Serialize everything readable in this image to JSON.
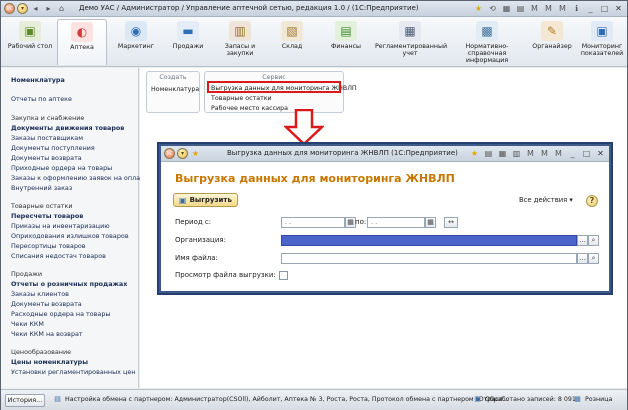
{
  "window": {
    "title": "Демо УАС / Администратор / Управление аптечной сетью, редакция 1.0 / (1С:Предприятие)"
  },
  "toolbar": {
    "items": [
      {
        "label": "Рабочий стол",
        "icon": "desktop-icon"
      },
      {
        "label": "Аптека",
        "icon": "pill-icon"
      },
      {
        "label": "Маркетинг",
        "icon": "marketing-icon"
      },
      {
        "label": "Продажи",
        "icon": "cart-icon"
      },
      {
        "label": "Запасы и закупки",
        "icon": "stock-icon"
      },
      {
        "label": "Склад",
        "icon": "warehouse-icon"
      },
      {
        "label": "Финансы",
        "icon": "money-icon"
      },
      {
        "label": "Регламентированный учет",
        "icon": "regulated-icon"
      },
      {
        "label": "Нормативно-справочная информация",
        "icon": "reference-icon"
      },
      {
        "label": "Органайзер",
        "icon": "organizer-icon"
      },
      {
        "label": "Мониторинг показателей",
        "icon": "monitor-icon"
      }
    ]
  },
  "nav": {
    "nomenclature": "Номенклатура",
    "reports": "Отчеты по аптеке",
    "s1_title": "Закупка и снабжение",
    "s1_bold": "Документы движения товаров",
    "s1_items": [
      "Заказы поставщикам",
      "Документы поступления",
      "Документы возврата",
      "Приходные ордера на товары",
      "Заказы к оформлению заявок на оплату",
      "Внутренний заказ"
    ],
    "s2_title": "Товарные остатки",
    "s2_bold": "Пересчеты товаров",
    "s2_items": [
      "Приказы на инвентаризацию",
      "Оприходования излишков товаров",
      "Пересортицы товаров",
      "Списания недостач товаров"
    ],
    "s3_title": "Продажи",
    "s3_bold": "Отчеты о розничных продажах",
    "s3_items": [
      "Заказы клиентов",
      "Документы возврата",
      "Расходные ордера на товары",
      "Чеки ККМ",
      "Чеки ККМ на возврат"
    ],
    "s4_title": "Ценообразование",
    "s4_bold": "Цены номенклатуры",
    "s4_items": [
      "Установки регламентированных цен"
    ]
  },
  "groups": {
    "create_title": "Создать",
    "create_item": "Номенклатура",
    "service_title": "Сервис",
    "service_items": [
      "Выгрузка данных для мониторинга ЖНВЛП",
      "Товарные остатки",
      "Рабочее место кассира"
    ]
  },
  "dialog": {
    "title": "Выгрузка данных для мониторинга ЖНВЛП (1С:Предприятие)",
    "heading": "Выгрузка данных для мониторинга ЖНВЛП",
    "export_button": "Выгрузить",
    "all_actions": "Все действия",
    "period_label": "Период с:",
    "period_from": " .  .",
    "period_to_label": "по:",
    "period_to": " .  .",
    "org_label": "Организация:",
    "file_label": "Имя файла:",
    "view_label": "Просмотр файла выгрузки:"
  },
  "status": {
    "history": "История...",
    "message": "Настройка обмена с партнером: Администратор(CSOll), Айболит, Аптека № 3, Роста, Роста, Протокол обмена с партнером \"Отрасл...",
    "processed": "Обработано записей: 8 091",
    "retail": "Розница"
  },
  "colors": {
    "accent_orange": "#c77700",
    "highlight_red": "#d81a1a",
    "dialog_border": "#3e5a8a",
    "org_field": "#4c63c9"
  }
}
